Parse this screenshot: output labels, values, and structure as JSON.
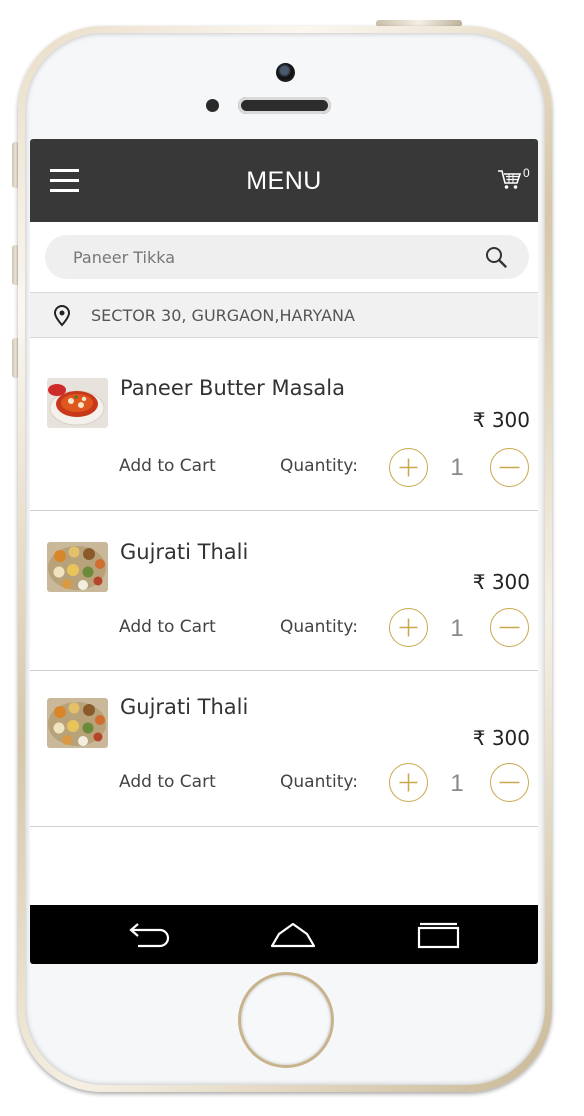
{
  "app_bar": {
    "title": "MENU",
    "menu_icon": "hamburger-menu-icon",
    "cart_icon": "shopping-cart-icon",
    "cart_count": "0",
    "background": "#383838"
  },
  "search": {
    "placeholder": "Paneer Tikka",
    "icon": "search-icon"
  },
  "location": {
    "icon": "location-pin-icon",
    "text": "SECTOR 30, GURGAON,HARYANA"
  },
  "items": [
    {
      "name": "Paneer Butter Masala",
      "price": "₹ 300",
      "add_to_cart": "Add to Cart",
      "quantity_label": "Quantity:",
      "quantity": "1",
      "image": "paneer-dish-thumbnail"
    },
    {
      "name": "Gujrati Thali",
      "price": "₹ 300",
      "add_to_cart": "Add to Cart",
      "quantity_label": "Quantity:",
      "quantity": "1",
      "image": "thali-thumbnail"
    },
    {
      "name": "Gujrati Thali",
      "price": "₹ 300",
      "add_to_cart": "Add to Cart",
      "quantity_label": "Quantity:",
      "quantity": "1",
      "image": "thali-thumbnail"
    }
  ],
  "nav_bar": {
    "back_icon": "back-arrow-icon",
    "home_icon": "home-icon",
    "recents_icon": "recent-apps-icon"
  },
  "colors": {
    "accent_gold": "#c9a84f",
    "app_bar": "#383838",
    "nav_bar": "#000000"
  }
}
